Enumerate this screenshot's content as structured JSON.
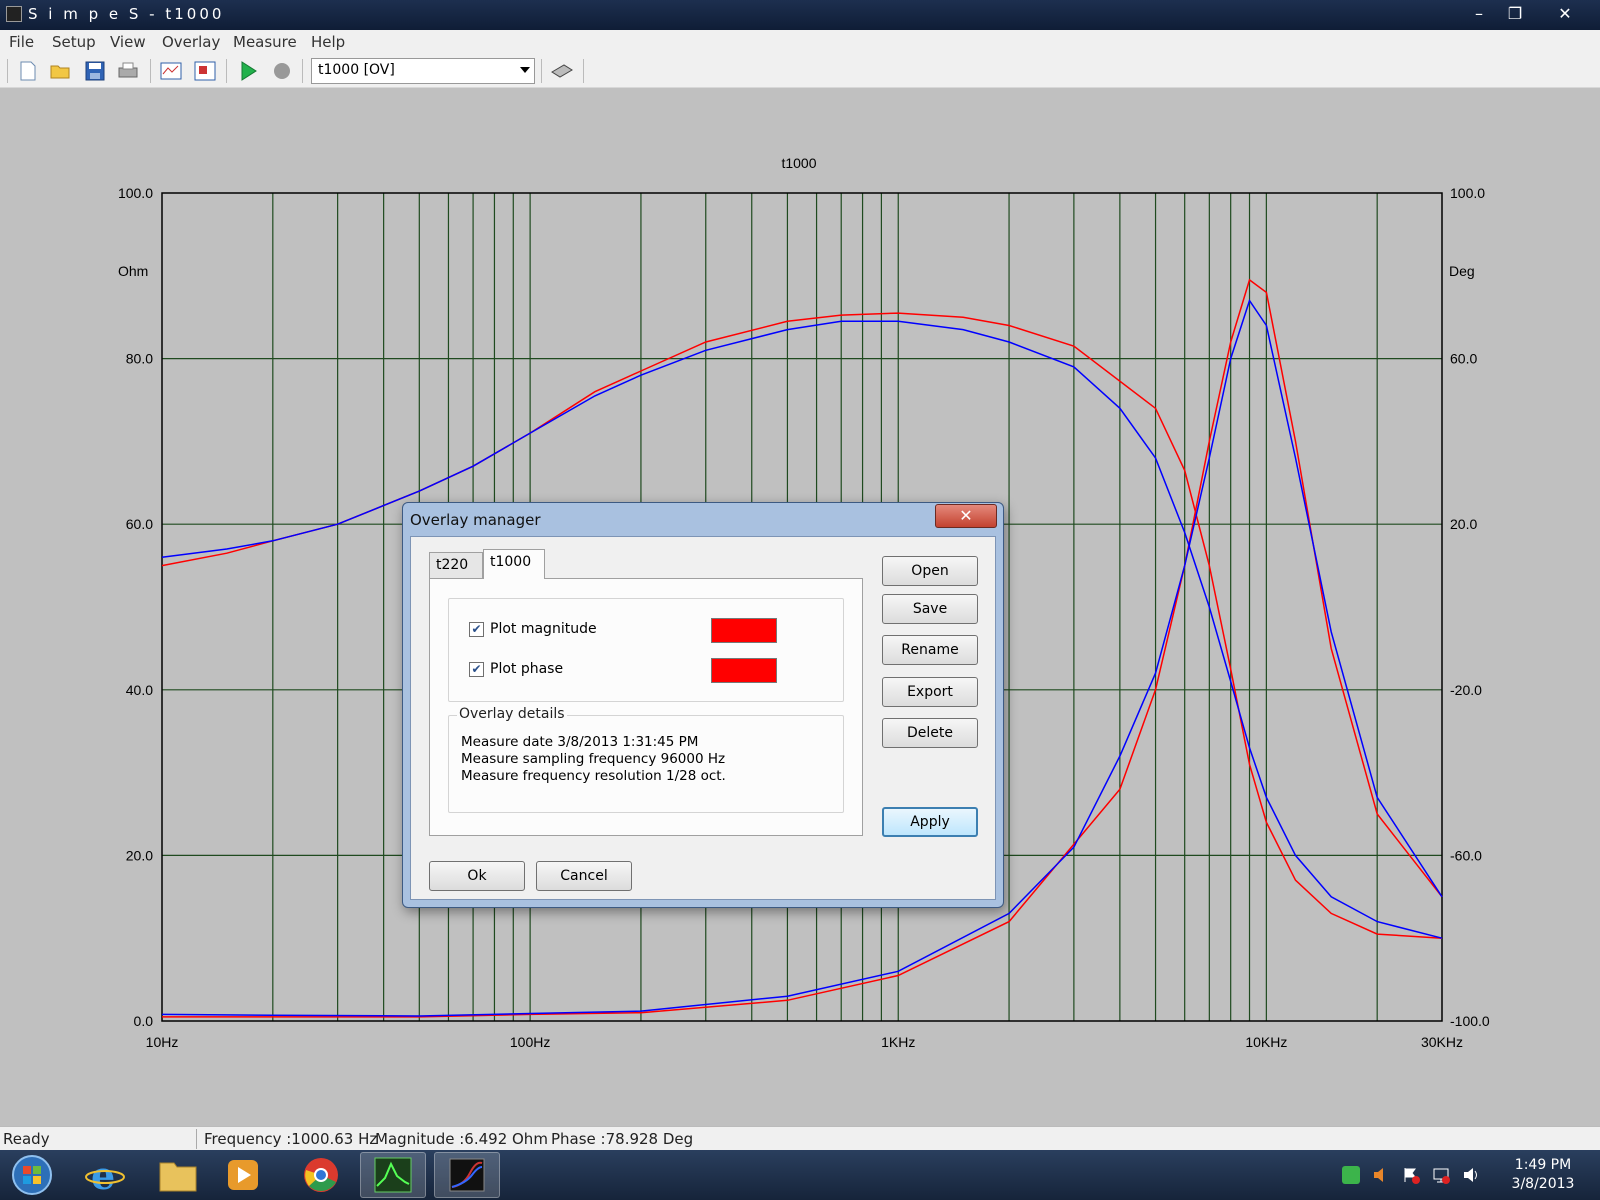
{
  "window": {
    "title": "S i m p e S - t1000"
  },
  "menu": {
    "items": [
      "File",
      "Setup",
      "View",
      "Overlay",
      "Measure",
      "Help"
    ]
  },
  "toolbar": {
    "buttons": [
      "new-icon",
      "open-icon",
      "save-icon",
      "print-icon",
      "chart-icon",
      "overlay-icon",
      "play-icon",
      "stop-icon",
      "calibrate-icon"
    ],
    "combo_value": "t1000 [OV]"
  },
  "chart_data": {
    "type": "line",
    "title": "t1000",
    "xscale": "log",
    "xlim": [
      10,
      30000
    ],
    "ylim_left": [
      0,
      100
    ],
    "ylim_right": [
      -100,
      100
    ],
    "ylabel_left": "Ohm",
    "ylabel_right": "Deg",
    "y_left_ticks": [
      "100.0",
      "80.0",
      "60.0",
      "40.0",
      "20.0",
      "0.0"
    ],
    "y_right_ticks": [
      "100.0",
      "60.0",
      "20.0",
      "-20.0",
      "-60.0",
      "-100.0"
    ],
    "x_tick_labels": [
      {
        "value": 10,
        "label": "10Hz"
      },
      {
        "value": 100,
        "label": "100Hz"
      },
      {
        "value": 1000,
        "label": "1KHz"
      },
      {
        "value": 10000,
        "label": "10KHz"
      },
      {
        "value": 30000,
        "label": "30KHz"
      }
    ],
    "grid": true,
    "series": [
      {
        "color": "#ff0000",
        "magnitude": {
          "x": [
            10,
            20,
            50,
            100,
            200,
            500,
            1000,
            2000,
            4000,
            5000,
            6000,
            7000,
            8000,
            9000,
            10000,
            12000,
            15000,
            20000,
            30000
          ],
          "y": [
            0.5,
            0.5,
            0.5,
            0.8,
            1.0,
            2.5,
            5.5,
            12.0,
            28.0,
            40.0,
            55.0,
            70.0,
            82.0,
            89.5,
            88.0,
            70.0,
            45.0,
            25.0,
            15.0
          ]
        },
        "phase": {
          "x": [
            10,
            15,
            20,
            30,
            50,
            70,
            100,
            150,
            200,
            300,
            500,
            700,
            1000,
            1500,
            2000,
            3000,
            5000,
            6000,
            7000,
            8000,
            9000,
            10000,
            12000,
            15000,
            20000,
            30000
          ],
          "y": [
            10,
            13,
            16,
            20,
            28,
            34,
            42,
            52,
            57,
            64,
            69,
            70.5,
            71,
            70,
            68,
            63,
            48,
            33,
            10,
            -15,
            -38,
            -52,
            -66,
            -74,
            -79,
            -80
          ]
        }
      },
      {
        "color": "#0000ff",
        "magnitude": {
          "x": [
            10,
            20,
            50,
            100,
            200,
            500,
            1000,
            2000,
            3000,
            4000,
            5000,
            6000,
            7000,
            8000,
            9000,
            10000,
            12000,
            15000,
            20000,
            30000
          ],
          "y": [
            0.8,
            0.7,
            0.6,
            0.9,
            1.2,
            3.0,
            6.0,
            13.0,
            21.0,
            32.0,
            42.0,
            55.0,
            68.0,
            80.0,
            87.0,
            84.0,
            68.0,
            47.0,
            27.0,
            15.0
          ]
        },
        "phase": {
          "x": [
            10,
            15,
            20,
            30,
            50,
            70,
            100,
            150,
            200,
            300,
            500,
            700,
            1000,
            1500,
            2000,
            3000,
            4000,
            5000,
            6000,
            7000,
            8000,
            9000,
            10000,
            12000,
            15000,
            20000,
            30000
          ],
          "y": [
            12,
            14,
            16,
            20,
            28,
            34,
            42,
            51,
            56,
            62,
            67,
            69,
            69,
            67,
            64,
            58,
            48,
            36,
            18,
            0,
            -18,
            -34,
            -46,
            -60,
            -70,
            -76,
            -80
          ]
        }
      }
    ]
  },
  "dialog": {
    "title": "Overlay manager",
    "tabs": [
      "t220",
      "t1000"
    ],
    "active_tab": "t1000",
    "plot_magnitude": {
      "label": "Plot magnitude",
      "checked": true,
      "color": "#ff0000"
    },
    "plot_phase": {
      "label": "Plot phase",
      "checked": true,
      "color": "#ff0000"
    },
    "details_title": "Overlay details",
    "details": [
      "Measure date 3/8/2013 1:31:45 PM",
      "Measure sampling frequency 96000 Hz",
      "Measure frequency resolution 1/28 oct."
    ],
    "buttons": {
      "open": "Open",
      "save": "Save",
      "rename": "Rename",
      "export": "Export",
      "delete": "Delete",
      "apply": "Apply",
      "ok": "Ok",
      "cancel": "Cancel"
    }
  },
  "status": {
    "ready": "Ready",
    "frequency": "Frequency :1000.63 Hz",
    "magnitude": "Magnitude :6.492 Ohm",
    "phase": "Phase :78.928 Deg"
  },
  "taskbar": {
    "apps": [
      "start-orb-icon",
      "internet-explorer-icon",
      "file-explorer-icon",
      "media-player-icon",
      "chrome-icon",
      "spectrum-app-icon",
      "simpes-icon"
    ],
    "time": "1:49 PM",
    "date": "3/8/2013"
  }
}
